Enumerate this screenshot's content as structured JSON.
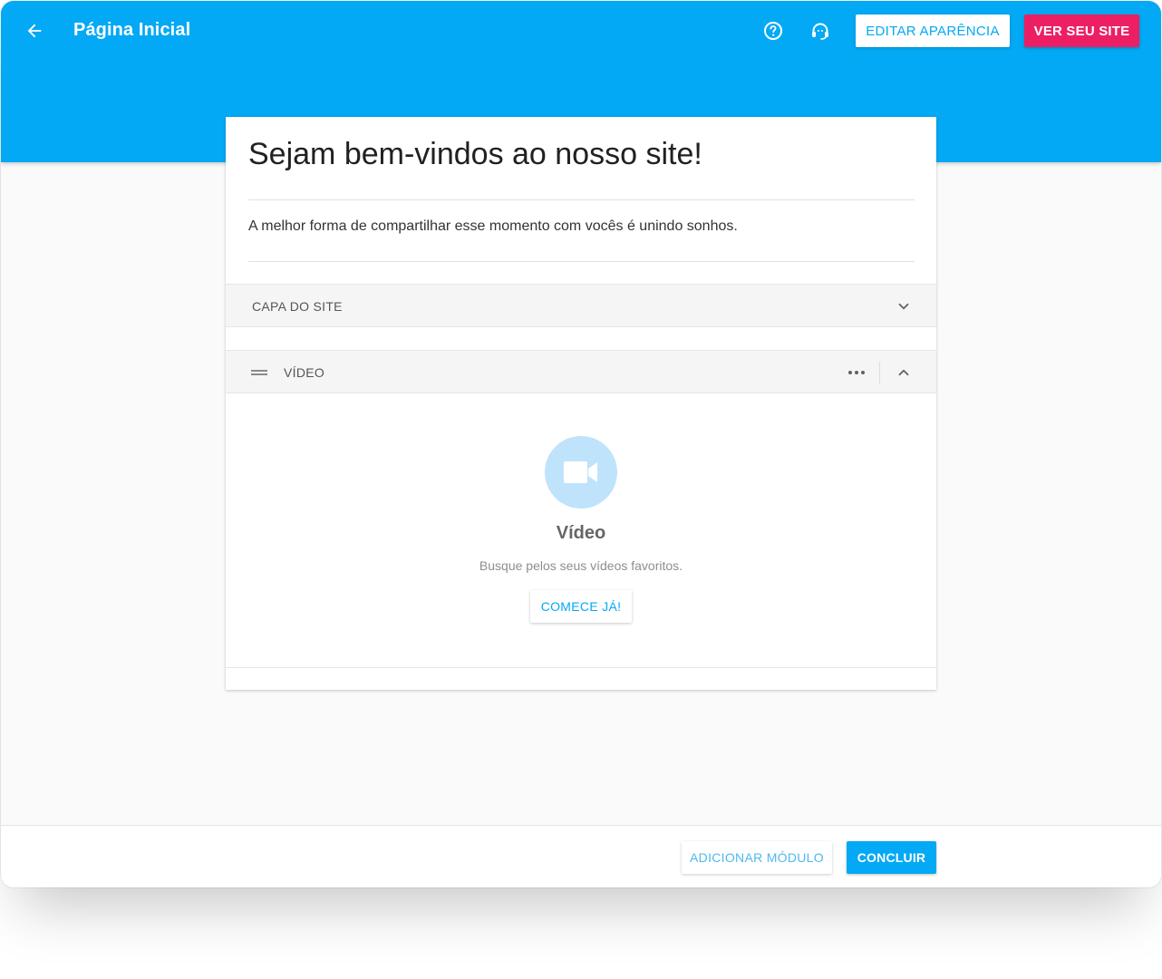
{
  "header": {
    "title": "Página Inicial",
    "edit_appearance_label": "EDITAR APARÊNCIA",
    "view_site_label": "VER SEU SITE",
    "icons": [
      "arrow-left-icon",
      "help-circle-icon",
      "support-headset-icon"
    ]
  },
  "content": {
    "title": "Sejam bem-vindos ao nosso site!",
    "subtitle": "A melhor forma de compartilhar esse momento com vocês é unindo sonhos."
  },
  "sections": {
    "cover": {
      "label": "CAPA DO SITE"
    },
    "video": {
      "label": "VÍDEO",
      "placeholder_title": "Vídeo",
      "placeholder_description": "Busque pelos seus vídeos favoritos.",
      "start_label": "COMECE JÁ!"
    }
  },
  "footer": {
    "add_module_label": "ADICIONAR MÓDULO",
    "done_label": "CONCLUIR"
  },
  "colors": {
    "primary": "#03a9f4",
    "accent": "#ec1f64",
    "video_circle": "#bfe3fb"
  }
}
